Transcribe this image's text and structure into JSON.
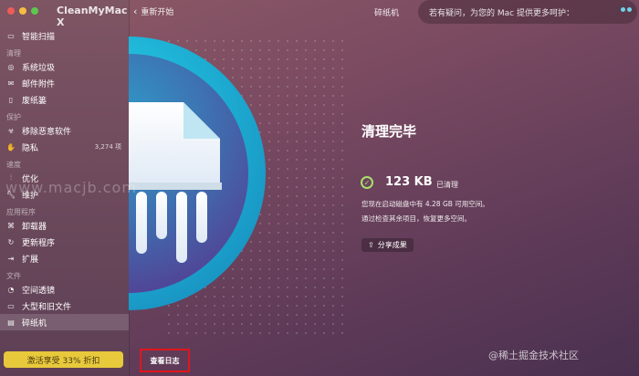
{
  "window": {
    "app_title": "CleanMyMac X",
    "traffic_lights": [
      "#ee5d56",
      "#f5bd42",
      "#5fc74d"
    ]
  },
  "topbar": {
    "back_label": "重新开始",
    "module_title": "碎纸机",
    "help_text": "若有疑问，为您的 Mac 提供更多呵护："
  },
  "sidebar": {
    "smart_scan": "智能扫描",
    "sections": [
      {
        "header": "清理",
        "items": [
          "系统垃圾",
          "邮件附件",
          "废纸篓"
        ]
      },
      {
        "header": "保护",
        "items": [
          "移除恶意软件",
          "隐私"
        ]
      },
      {
        "header": "速度",
        "items": [
          "优化",
          "维护"
        ]
      },
      {
        "header": "应用程序",
        "items": [
          "卸载器",
          "更新程序",
          "扩展"
        ]
      },
      {
        "header": "文件",
        "items": [
          "空间透镜",
          "大型和旧文件",
          "碎纸机"
        ]
      }
    ],
    "privacy_count": "3,274 项",
    "promo_label": "激活享受 33% 折扣"
  },
  "main": {
    "done_title": "清理完毕",
    "size": "123 KB",
    "cleaned_label": "已清理",
    "desc_line1": "您现在启动磁盘中有 4.28 GB 可用空间。",
    "desc_line2": "通过检查其余项目，恢复更多空间。",
    "share_label": "分享成果",
    "view_log_label": "查看日志"
  },
  "watermarks": {
    "site": "www.macjb.com",
    "corner": "@稀土掘金技术社区"
  },
  "colors": {
    "accent_teal": "#2fd6e8",
    "promo_yellow": "#e8c93c",
    "highlight_red": "#e0161b",
    "check_green": "#a8e06a"
  }
}
